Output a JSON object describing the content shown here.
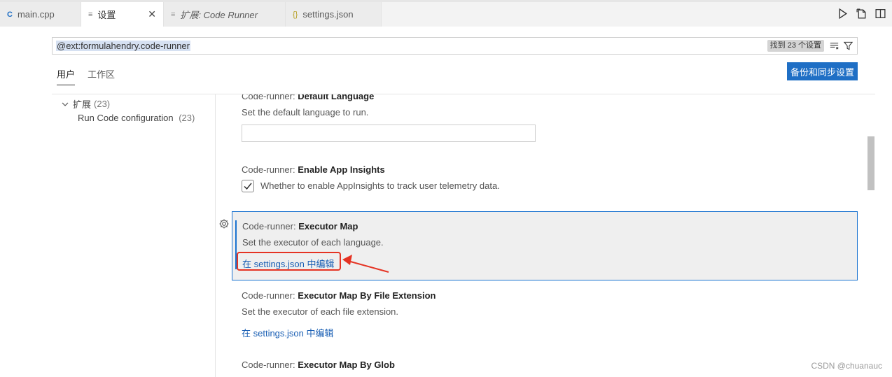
{
  "tabs": [
    {
      "label": "main.cpp",
      "icon": "c-plus-plus-icon",
      "icon_glyph": "C",
      "active": false,
      "italic": false
    },
    {
      "label": "设置",
      "icon": "settings-file-icon",
      "icon_glyph": "≡",
      "active": true,
      "italic": false,
      "closable": true
    },
    {
      "label": "扩展: Code Runner",
      "icon": "extension-icon",
      "icon_glyph": "≡",
      "active": false,
      "italic": true
    },
    {
      "label": "settings.json",
      "icon": "json-braces-icon",
      "icon_glyph": "{}",
      "active": false,
      "italic": false
    }
  ],
  "search": {
    "value": "@ext:formulahendry.code-runner",
    "result_count": "找到 23 个设置"
  },
  "scope_tabs": [
    {
      "label": "用户",
      "active": true
    },
    {
      "label": "工作区",
      "active": false
    }
  ],
  "backup_button": "备份和同步设置",
  "toc": {
    "group_label": "扩展",
    "group_count": "(23)",
    "item_label": "Run Code configuration",
    "item_count": "(23)"
  },
  "settings": [
    {
      "prefix": "Code-runner:",
      "name": "Default Language",
      "description": "Set the default language to run.",
      "control": "text"
    },
    {
      "prefix": "Code-runner:",
      "name": "Enable App Insights",
      "description": "Whether to enable AppInsights to track user telemetry data.",
      "control": "checkbox",
      "checked": true
    },
    {
      "prefix": "Code-runner:",
      "name": "Executor Map",
      "description": "Set the executor of each language.",
      "link": "在 settings.json 中编辑",
      "focused": true
    },
    {
      "prefix": "Code-runner:",
      "name": "Executor Map By File Extension",
      "description": "Set the executor of each file extension.",
      "link": "在 settings.json 中编辑"
    },
    {
      "prefix": "Code-runner:",
      "name": "Executor Map By Glob"
    }
  ],
  "watermark": "CSDN @chuanauc",
  "colors": {
    "accent": "#1f6fc5",
    "link": "#1a5fb4",
    "annotation_red": "#e53323",
    "focus_border": "#1a73d0"
  }
}
